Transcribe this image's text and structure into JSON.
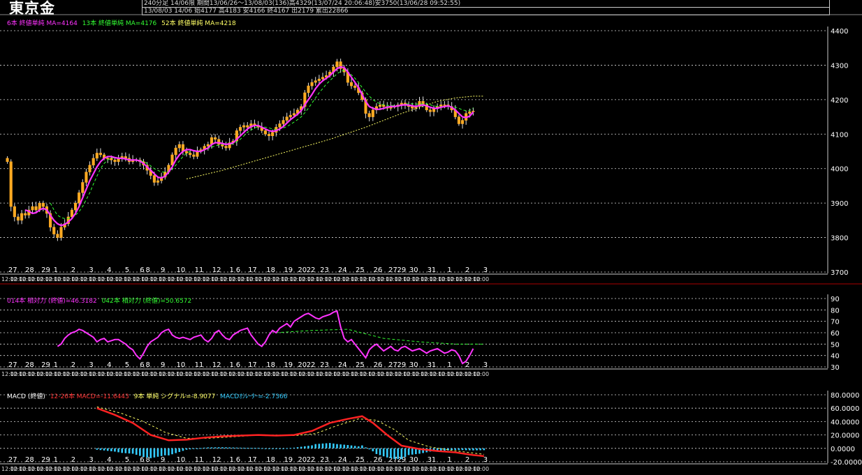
{
  "header": {
    "symbol": "東京金",
    "line1": "240分足 14/06限 期間13/06/26～13/08/03(136)高4329(13/07/24 20:06:48)安3750(13/06/28 09:52:55)",
    "line2": "13/08/03 14/06 始4177 高4183 安4166 終4167 出2179 累出22866"
  },
  "legends": {
    "main": [
      {
        "text": "6本 終値単純 MA=4164",
        "color": "#ff33ff"
      },
      {
        "text": "13本 終値単純 MA=4176",
        "color": "#33ff33"
      },
      {
        "text": "52本 終値単純 MA=4218",
        "color": "#ffff66"
      }
    ],
    "rsi": [
      {
        "text": "014本 相対力 (終値)=46.3182",
        "color": "#ff33ff"
      },
      {
        "text": "042本 相対力 (終値)=50.6572",
        "color": "#33ff33"
      }
    ],
    "macd": [
      {
        "text": "MACD (終値)",
        "color": "#ffffff"
      },
      {
        "text": "12-26本 MACD=-11.6443",
        "color": "#ff3333"
      },
      {
        "text": "9本 単純 シグナル=-8.9077",
        "color": "#ffff66"
      },
      {
        "text": "MACDｵｼﾚｰﾀｰ=-2.7366",
        "color": "#33ccff"
      }
    ]
  },
  "date_labels": [
    "27",
    "28",
    "29",
    "1",
    "2",
    "3",
    "4",
    "5",
    "6",
    "8",
    "9",
    "10",
    "11",
    "12",
    "13",
    "16",
    "17",
    "18",
    "19",
    "20",
    "22",
    "23",
    "24",
    "25",
    "26",
    "27",
    "29",
    "30",
    "31",
    "1",
    "2",
    "3"
  ],
  "date_markers": [
    {
      "label": "27",
      "x_bar": 1.5
    },
    {
      "label": "28",
      "x_bar": 6.2
    },
    {
      "label": "29",
      "x_bar": 10.7
    },
    {
      "label": "1",
      "x_bar": 13.5
    },
    {
      "label": "2",
      "x_bar": 18.4
    },
    {
      "label": "3",
      "x_bar": 23.4
    },
    {
      "label": "4",
      "x_bar": 28.4
    },
    {
      "label": "5",
      "x_bar": 33.4
    },
    {
      "label": "6",
      "x_bar": 37.6
    },
    {
      "label": "8",
      "x_bar": 39.2
    },
    {
      "label": "9",
      "x_bar": 43.4
    },
    {
      "label": "10",
      "x_bar": 48.4
    },
    {
      "label": "11",
      "x_bar": 53.5
    },
    {
      "label": "12",
      "x_bar": 58.4
    },
    {
      "label": "1",
      "x_bar": 62.6
    },
    {
      "label": "6",
      "x_bar": 64.4
    },
    {
      "label": "17",
      "x_bar": 68.4
    },
    {
      "label": "18",
      "x_bar": 73.5
    },
    {
      "label": "19",
      "x_bar": 78.4
    },
    {
      "label": "20",
      "x_bar": 82.3
    },
    {
      "label": "22",
      "x_bar": 84.7
    },
    {
      "label": "23",
      "x_bar": 88.5
    },
    {
      "label": "24",
      "x_bar": 93.5
    },
    {
      "label": "25",
      "x_bar": 98.4
    },
    {
      "label": "26",
      "x_bar": 103.4
    },
    {
      "label": "27",
      "x_bar": 107.6
    },
    {
      "label": "29",
      "x_bar": 110.0
    },
    {
      "label": "30",
      "x_bar": 113.4
    },
    {
      "label": "31",
      "x_bar": 118.4
    },
    {
      "label": "1",
      "x_bar": 123.4
    },
    {
      "label": "2",
      "x_bar": 128.4
    },
    {
      "label": "3",
      "x_bar": 133.4
    }
  ],
  "time_label": "12:00",
  "chart_data": [
    {
      "type": "candlestick",
      "title": "東京金 240分足",
      "ylim": [
        3700,
        4450
      ],
      "yticks": [
        3700,
        3800,
        3900,
        4000,
        4100,
        4200,
        4300,
        4400
      ],
      "grid": true,
      "close": [
        4020,
        3890,
        3860,
        3850,
        3870,
        3865,
        3880,
        3890,
        3880,
        3900,
        3890,
        3870,
        3830,
        3810,
        3800,
        3830,
        3840,
        3860,
        3880,
        3900,
        3930,
        3960,
        3990,
        4010,
        4030,
        4045,
        4040,
        4030,
        4030,
        4025,
        4020,
        4030,
        4035,
        4030,
        4020,
        4025,
        4025,
        4020,
        4010,
        3995,
        3980,
        3960,
        3965,
        3975,
        3990,
        4010,
        4040,
        4060,
        4070,
        4050,
        4045,
        4040,
        4035,
        4050,
        4055,
        4065,
        4070,
        4090,
        4085,
        4070,
        4065,
        4060,
        4075,
        4080,
        4110,
        4120,
        4125,
        4120,
        4130,
        4125,
        4120,
        4110,
        4100,
        4095,
        4105,
        4120,
        4130,
        4140,
        4150,
        4155,
        4160,
        4170,
        4180,
        4220,
        4240,
        4250,
        4255,
        4260,
        4265,
        4270,
        4280,
        4295,
        4310,
        4290,
        4280,
        4250,
        4240,
        4235,
        4220,
        4200,
        4160,
        4150,
        4170,
        4180,
        4185,
        4180,
        4175,
        4180,
        4180,
        4185,
        4190,
        4185,
        4180,
        4175,
        4180,
        4195,
        4185,
        4170,
        4165,
        4175,
        4180,
        4185,
        4185,
        4180,
        4170,
        4150,
        4130,
        4140,
        4160,
        4165,
        4167
      ],
      "ma6": [
        null,
        null,
        null,
        null,
        null,
        3880,
        3876,
        3870,
        3872,
        3880,
        3885,
        3880,
        3865,
        3850,
        3840,
        3835,
        3838,
        3845,
        3855,
        3870,
        3890,
        3915,
        3940,
        3965,
        3985,
        4005,
        4020,
        4030,
        4035,
        4035,
        4032,
        4030,
        4030,
        4028,
        4025,
        4025,
        4025,
        4022,
        4015,
        4005,
        3995,
        3985,
        3975,
        3973,
        3978,
        3990,
        4005,
        4025,
        4040,
        4050,
        4055,
        4055,
        4052,
        4050,
        4050,
        4055,
        4060,
        4070,
        4075,
        4075,
        4073,
        4070,
        4072,
        4075,
        4085,
        4095,
        4105,
        4115,
        4122,
        4125,
        4125,
        4120,
        4115,
        4110,
        4108,
        4110,
        4115,
        4122,
        4132,
        4142,
        4150,
        4158,
        4168,
        4185,
        4200,
        4215,
        4232,
        4245,
        4255,
        4262,
        4270,
        4280,
        4290,
        4295,
        4293,
        4280,
        4265,
        4250,
        4235,
        4215,
        4195,
        4180,
        4175,
        4172,
        4172,
        4175,
        4178,
        4180,
        4180,
        4182,
        4184,
        4185,
        4184,
        4182,
        4180,
        4183,
        4185,
        4182,
        4178,
        4175,
        4175,
        4178,
        4180,
        4182,
        4178,
        4170,
        4160,
        4150,
        4148,
        4152,
        4164
      ],
      "ma13": [
        null,
        null,
        null,
        null,
        null,
        null,
        null,
        null,
        null,
        null,
        null,
        null,
        3900,
        3880,
        3865,
        3858,
        3855,
        3855,
        3858,
        3865,
        3875,
        3890,
        3910,
        3930,
        3955,
        3978,
        4000,
        4015,
        4025,
        4030,
        4032,
        4030,
        4030,
        4028,
        4026,
        4025,
        4025,
        4024,
        4020,
        4015,
        4008,
        4000,
        3995,
        3990,
        3990,
        3992,
        3998,
        4010,
        4022,
        4035,
        4045,
        4050,
        4052,
        4052,
        4052,
        4055,
        4058,
        4062,
        4066,
        4068,
        4070,
        4070,
        4070,
        4072,
        4078,
        4085,
        4095,
        4105,
        4112,
        4118,
        4122,
        4122,
        4120,
        4118,
        4115,
        4113,
        4115,
        4118,
        4122,
        4128,
        4135,
        4142,
        4150,
        4162,
        4175,
        4190,
        4205,
        4220,
        4232,
        4245,
        4255,
        4265,
        4275,
        4282,
        4285,
        4280,
        4272,
        4262,
        4250,
        4235,
        4222,
        4210,
        4200,
        4193,
        4188,
        4185,
        4183,
        4183,
        4183,
        4183,
        4185,
        4187,
        4188,
        4188,
        4187,
        4187,
        4188,
        4188,
        4185,
        4182,
        4180,
        4180,
        4180,
        4180,
        4180,
        4178,
        4175,
        4170,
        4168,
        4168,
        4176
      ],
      "ma52": [
        {
          "i": 50,
          "v": 3970
        },
        {
          "i": 60,
          "v": 3995
        },
        {
          "i": 70,
          "v": 4025
        },
        {
          "i": 80,
          "v": 4055
        },
        {
          "i": 90,
          "v": 4085
        },
        {
          "i": 100,
          "v": 4120
        },
        {
          "i": 110,
          "v": 4160
        },
        {
          "i": 120,
          "v": 4195
        },
        {
          "i": 125,
          "v": 4205
        },
        {
          "i": 130,
          "v": 4210
        },
        {
          "i": 133,
          "v": 4210
        }
      ]
    },
    {
      "type": "line",
      "title": "相対力",
      "ylim": [
        30,
        90
      ],
      "yticks": [
        30,
        40,
        50,
        60,
        70,
        80,
        90
      ],
      "rsi14": [
        null,
        null,
        null,
        null,
        null,
        null,
        null,
        null,
        null,
        null,
        null,
        null,
        null,
        null,
        48,
        50,
        55,
        58,
        60,
        61,
        63,
        62,
        60,
        58,
        56,
        52,
        54,
        55,
        52,
        53,
        54,
        54,
        52,
        50,
        47,
        45,
        40,
        37,
        42,
        48,
        52,
        54,
        56,
        60,
        62,
        63,
        58,
        56,
        55,
        56,
        55,
        54,
        56,
        57,
        58,
        54,
        52,
        55,
        60,
        62,
        58,
        55,
        54,
        58,
        60,
        62,
        63,
        64,
        58,
        54,
        50,
        48,
        52,
        58,
        62,
        60,
        64,
        66,
        68,
        65,
        70,
        72,
        74,
        76,
        77,
        75,
        73,
        72,
        74,
        75,
        76,
        78,
        79,
        65,
        55,
        52,
        54,
        50,
        46,
        42,
        38,
        45,
        48,
        50,
        47,
        44,
        46,
        48,
        45,
        44,
        47,
        48,
        46,
        44,
        45,
        46,
        44,
        42,
        44,
        45,
        46,
        44,
        42,
        43,
        45,
        44,
        40,
        33,
        35,
        40,
        46
      ],
      "rsi42": [
        {
          "i": 75,
          "v": 60
        },
        {
          "i": 85,
          "v": 62
        },
        {
          "i": 95,
          "v": 63
        },
        {
          "i": 105,
          "v": 55
        },
        {
          "i": 115,
          "v": 52
        },
        {
          "i": 125,
          "v": 50
        },
        {
          "i": 133,
          "v": 50
        }
      ]
    },
    {
      "type": "line",
      "title": "MACD",
      "ylim": [
        -20,
        80
      ],
      "yticks": [
        -20,
        0,
        20,
        40,
        60,
        80
      ],
      "yticklabels": [
        "-20.0000",
        "0.0000",
        "20.0000",
        "40.0000",
        "60.0000",
        "80.0000"
      ],
      "macd": [
        {
          "i": 25,
          "v": 60
        },
        {
          "i": 30,
          "v": 50
        },
        {
          "i": 35,
          "v": 38
        },
        {
          "i": 40,
          "v": 20
        },
        {
          "i": 45,
          "v": 12
        },
        {
          "i": 50,
          "v": 13
        },
        {
          "i": 55,
          "v": 16
        },
        {
          "i": 60,
          "v": 18
        },
        {
          "i": 65,
          "v": 19
        },
        {
          "i": 70,
          "v": 20
        },
        {
          "i": 75,
          "v": 19
        },
        {
          "i": 80,
          "v": 20
        },
        {
          "i": 85,
          "v": 26
        },
        {
          "i": 90,
          "v": 38
        },
        {
          "i": 95,
          "v": 44
        },
        {
          "i": 99,
          "v": 48
        },
        {
          "i": 102,
          "v": 38
        },
        {
          "i": 106,
          "v": 20
        },
        {
          "i": 110,
          "v": 4
        },
        {
          "i": 115,
          "v": -1
        },
        {
          "i": 120,
          "v": -4
        },
        {
          "i": 125,
          "v": -6
        },
        {
          "i": 130,
          "v": -10
        },
        {
          "i": 133,
          "v": -11.6
        }
      ],
      "signal": [
        {
          "i": 25,
          "v": 62
        },
        {
          "i": 32,
          "v": 52
        },
        {
          "i": 38,
          "v": 40
        },
        {
          "i": 44,
          "v": 24
        },
        {
          "i": 50,
          "v": 15
        },
        {
          "i": 56,
          "v": 15
        },
        {
          "i": 62,
          "v": 17
        },
        {
          "i": 68,
          "v": 19
        },
        {
          "i": 74,
          "v": 20
        },
        {
          "i": 80,
          "v": 19
        },
        {
          "i": 86,
          "v": 22
        },
        {
          "i": 92,
          "v": 34
        },
        {
          "i": 98,
          "v": 44
        },
        {
          "i": 103,
          "v": 42
        },
        {
          "i": 108,
          "v": 28
        },
        {
          "i": 112,
          "v": 12
        },
        {
          "i": 118,
          "v": 2
        },
        {
          "i": 124,
          "v": -3
        },
        {
          "i": 130,
          "v": -7
        },
        {
          "i": 133,
          "v": -8.9
        }
      ],
      "histogram_note": "MACD oscillator bars"
    }
  ]
}
